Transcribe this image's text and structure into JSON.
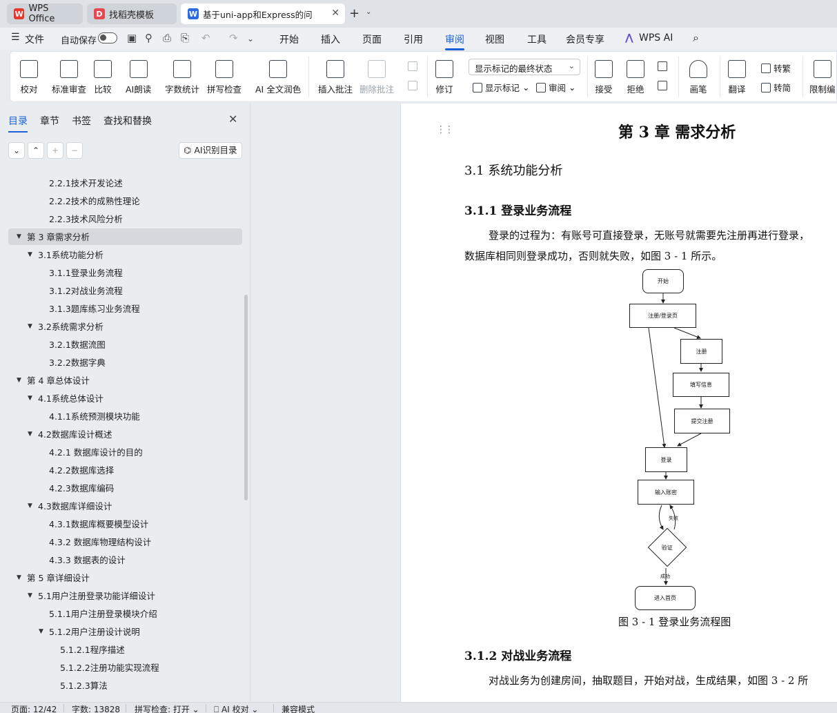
{
  "tabs": [
    {
      "label": "WPS Office",
      "icon": "wps-logo-icon"
    },
    {
      "label": "找稻壳模板",
      "icon": "daoke-icon"
    },
    {
      "label": "基于uni-app和Express的问",
      "icon": "writer-icon"
    }
  ],
  "menu": {
    "file": "文件",
    "autosave": "自动保存",
    "items": [
      "开始",
      "插入",
      "页面",
      "引用",
      "审阅",
      "视图",
      "工具",
      "会员专享",
      "WPS AI"
    ],
    "active": "审阅"
  },
  "ribbon": {
    "proofread": "校对",
    "standard_review": "标准审查",
    "compare": "比较",
    "ai_read": "AI朗读",
    "word_count": "字数统计",
    "spell_check": "拼写检查",
    "ai_polish": "AI 全文润色",
    "insert_comment": "插入批注",
    "delete_comment": "删除批注",
    "revise": "修订",
    "markup_select": "显示标记的最终状态",
    "show_markup": "显示标记",
    "review": "审阅",
    "accept": "接受",
    "reject": "拒绝",
    "pen": "画笔",
    "translate": "翻译",
    "to_traditional": "转繁",
    "to_simplified": "转简",
    "restrict_edit": "限制编"
  },
  "sidebar": {
    "tabs": [
      "目录",
      "章节",
      "书签",
      "查找和替换"
    ],
    "ai_toc": "AI识别目录",
    "toc": [
      {
        "label": "2.2.1技术开发论述",
        "level": 3,
        "arrow": false
      },
      {
        "label": "2.2.2技术的成熟性理论",
        "level": 3,
        "arrow": false
      },
      {
        "label": "2.2.3技术风险分析",
        "level": 3,
        "arrow": false
      },
      {
        "label": "第 3 章需求分析",
        "level": 1,
        "arrow": true,
        "selected": true
      },
      {
        "label": "3.1系统功能分析",
        "level": 2,
        "arrow": true
      },
      {
        "label": "3.1.1登录业务流程",
        "level": 3,
        "arrow": false
      },
      {
        "label": "3.1.2对战业务流程",
        "level": 3,
        "arrow": false
      },
      {
        "label": "3.1.3题库练习业务流程",
        "level": 3,
        "arrow": false
      },
      {
        "label": "3.2系统需求分析",
        "level": 2,
        "arrow": true
      },
      {
        "label": "3.2.1数据流图",
        "level": 3,
        "arrow": false
      },
      {
        "label": "3.2.2数据字典",
        "level": 3,
        "arrow": false
      },
      {
        "label": "第 4 章总体设计",
        "level": 1,
        "arrow": true
      },
      {
        "label": "4.1系统总体设计",
        "level": 2,
        "arrow": true
      },
      {
        "label": "4.1.1系统预测模块功能",
        "level": 3,
        "arrow": false
      },
      {
        "label": "4.2数据库设计概述",
        "level": 2,
        "arrow": true
      },
      {
        "label": "4.2.1  数据库设计的目的",
        "level": 3,
        "arrow": false
      },
      {
        "label": "4.2.2数据库选择",
        "level": 3,
        "arrow": false
      },
      {
        "label": "4.2.3数据库编码",
        "level": 3,
        "arrow": false
      },
      {
        "label": "4.3数据库详细设计",
        "level": 2,
        "arrow": true
      },
      {
        "label": "4.3.1数据库概要模型设计",
        "level": 3,
        "arrow": false
      },
      {
        "label": "4.3.2  数据库物理结构设计",
        "level": 3,
        "arrow": false
      },
      {
        "label": "4.3.3    数据表的设计",
        "level": 3,
        "arrow": false
      },
      {
        "label": "第 5 章详细设计",
        "level": 1,
        "arrow": true
      },
      {
        "label": "5.1用户注册登录功能详细设计",
        "level": 2,
        "arrow": true
      },
      {
        "label": "5.1.1用户注册登录模块介绍",
        "level": 3,
        "arrow": false
      },
      {
        "label": "5.1.2用户注册设计说明",
        "level": 3,
        "arrow": true
      },
      {
        "label": "5.1.2.1程序描述",
        "level": 4,
        "arrow": false
      },
      {
        "label": "5.1.2.2注册功能实现流程",
        "level": 4,
        "arrow": false
      },
      {
        "label": "5.1.2.3算法",
        "level": 4,
        "arrow": false
      }
    ]
  },
  "document": {
    "chapter_title": "第 3 章  需求分析",
    "section_title": "3.1  系统功能分析",
    "sub1_title": "3.1.1  登录业务流程",
    "para1_line1": "登录的过程为：有账号可直接登录，无账号就需要先注册再进行登录，",
    "para1_line2": "数据库相同则登录成功，否则就失败，如图  3 - 1 所示。",
    "flowchart": {
      "start": "开始",
      "reg_login_page": "注册/登录页",
      "register": "注册",
      "fill_info": "填写信息",
      "submit": "提交注册",
      "login": "登录",
      "input_account": "输入账密",
      "verify": "验证",
      "fail": "失败",
      "success": "成功",
      "home": "进入首页"
    },
    "caption": "图  3 - 1  登录业务流程图",
    "sub2_title": "3.1.2  对战业务流程",
    "para2_line1": "对战业务为创建房间，抽取题目，开始对战，生成结果，如图  3 - 2 所"
  },
  "status": {
    "page": "页面: 12/42",
    "words": "字数: 13828",
    "spell": "拼写检查: 打开",
    "ai_proof": "AI 校对",
    "compat": "兼容模式"
  }
}
